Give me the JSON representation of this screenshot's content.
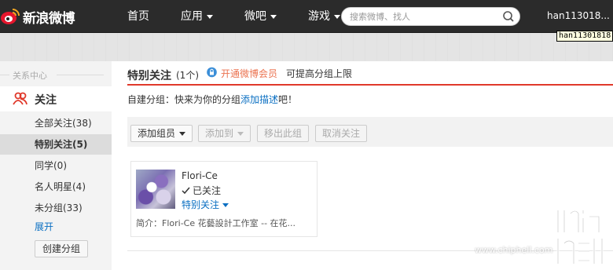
{
  "app": {
    "logo_text": "新浪微博"
  },
  "nav": {
    "items": [
      {
        "label": "首页",
        "dropdown": false
      },
      {
        "label": "应用",
        "dropdown": true
      },
      {
        "label": "微吧",
        "dropdown": true
      },
      {
        "label": "游戏",
        "dropdown": true
      }
    ],
    "search_placeholder": "搜索微博、找人",
    "username": "han113018...",
    "username_tooltip": "han11301818"
  },
  "sidebar": {
    "section_title": "关系中心",
    "follow_label": "关注",
    "items": [
      {
        "label": "全部关注(38)",
        "active": false
      },
      {
        "label": "特别关注(5)",
        "active": true
      },
      {
        "label": "同学(0)",
        "active": false
      },
      {
        "label": "名人明星(4)",
        "active": false
      },
      {
        "label": "未分组(33)",
        "active": false
      }
    ],
    "expand_label": "展开",
    "create_group_label": "创建分组"
  },
  "main": {
    "title": "特别关注",
    "count": "(1个)",
    "vip_link": "开通微博会员",
    "vip_text": "可提高分组上限",
    "hint_prefix": "自建分组：快来为你的分组",
    "hint_link": "添加描述",
    "hint_suffix": "吧！",
    "toolbar": {
      "add_member": "添加组员",
      "add_to": "添加到",
      "remove_from_group": "移出此组",
      "unfollow": "取消关注"
    },
    "card": {
      "name": "Flori-Ce",
      "followed": "已关注",
      "group": "特别关注",
      "intro": "简介：Flori-Ce 花藝設計工作室 -- 在花..."
    }
  },
  "watermark": {
    "text": "www.chiphell.com"
  },
  "colors": {
    "nav_bg": "#2b2b2b",
    "accent_red": "#e0392b",
    "link_blue": "#0a6fc2",
    "vip_orange": "#eb7350"
  }
}
